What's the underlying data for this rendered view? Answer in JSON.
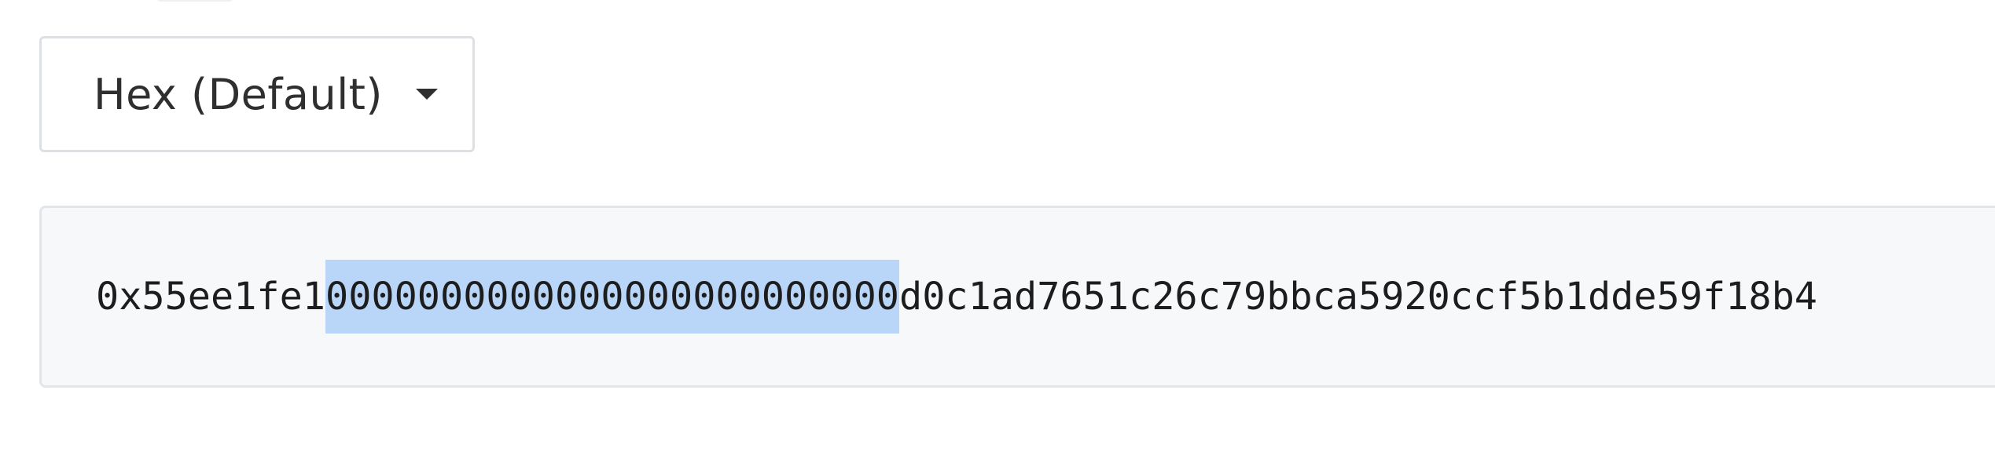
{
  "format_selector": {
    "selected": "Hex (Default)",
    "icon": "caret-down-icon"
  },
  "value_display": {
    "prefix": "0x55ee1fe1",
    "selected_text": "0000000000000000000000000",
    "suffix": "d0c1ad7651c26c79bbca5920ccf5b1dde59f18b4",
    "selection_color": "#b9d5f8"
  }
}
